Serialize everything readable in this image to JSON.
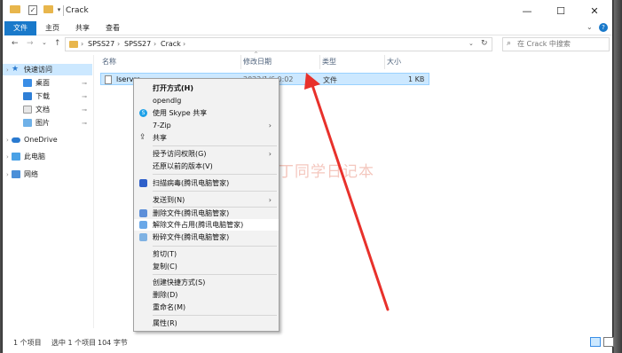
{
  "window": {
    "title": "Crack",
    "controls": {
      "minimize": "—",
      "maximize": "☐",
      "close": "✕"
    }
  },
  "ribbon": {
    "tabs": [
      "文件",
      "主页",
      "共享",
      "查看"
    ],
    "expand_glyph": "⌄",
    "help_glyph": "?"
  },
  "nav": {
    "back": "←",
    "forward": "→",
    "recent": "⌄",
    "up": "↑"
  },
  "address": {
    "crumbs": [
      "SPSS27",
      "SPSS27",
      "Crack"
    ],
    "separator": "›",
    "drop": "⌄",
    "refresh": "↻"
  },
  "search": {
    "placeholder": "在 Crack 中搜索",
    "icon": "⌕"
  },
  "sidebar": {
    "items": [
      {
        "label": "快速访问",
        "icon": "star-icon",
        "chev": "›",
        "selected": true
      },
      {
        "label": "桌面",
        "icon": "desktop-icon",
        "pinned": true
      },
      {
        "label": "下载",
        "icon": "download-icon",
        "pinned": true
      },
      {
        "label": "文档",
        "icon": "documents-icon",
        "pinned": true
      },
      {
        "label": "图片",
        "icon": "pictures-icon",
        "pinned": true
      },
      {
        "label": "OneDrive",
        "icon": "onedrive-icon",
        "chev": "›"
      },
      {
        "label": "此电脑",
        "icon": "pc-icon",
        "chev": "›"
      },
      {
        "label": "网络",
        "icon": "network-icon",
        "chev": "›"
      }
    ],
    "pin_glyph": "📌"
  },
  "columns": {
    "name": "名称",
    "date": "修改日期",
    "type": "类型",
    "size": "大小",
    "sort_glyph": "^"
  },
  "files": [
    {
      "name": "lservrc",
      "date": "2022/1/6 0:02",
      "type": "文件",
      "size": "1 KB"
    }
  ],
  "context_menu": {
    "items": [
      {
        "label": "打开方式(H)",
        "bold": true
      },
      {
        "label": "opendlg"
      },
      {
        "label": "使用 Skype 共享",
        "icon": "skype-icon",
        "icon_glyph": "S"
      },
      {
        "label": "7-Zip",
        "submenu": true
      },
      {
        "label": "共享",
        "icon": "share-icon",
        "icon_glyph": "⇪"
      },
      {
        "label": "授予访问权限(G)",
        "submenu": true
      },
      {
        "label": "还原以前的版本(V)"
      },
      {
        "label": "扫描病毒(腾讯电脑管家)",
        "icon": "shield-icon"
      },
      {
        "label": "发送到(N)",
        "submenu": true
      },
      {
        "label": "删除文件(腾讯电脑管家)",
        "icon": "delete-file-icon"
      },
      {
        "label": "解除文件占用(腾讯电脑管家)",
        "icon": "unlock-file-icon",
        "highlighted": true
      },
      {
        "label": "粉碎文件(腾讯电脑管家)",
        "icon": "shred-file-icon"
      },
      {
        "label": "剪切(T)"
      },
      {
        "label": "复制(C)"
      },
      {
        "label": "创建快捷方式(S)"
      },
      {
        "label": "删除(D)"
      },
      {
        "label": "重命名(M)"
      },
      {
        "label": "属性(R)"
      }
    ],
    "submenu_glyph": "›"
  },
  "watermark": {
    "text": "丁同学日记本"
  },
  "status": {
    "count": "1 个项目",
    "selected": "选中 1 个项目",
    "size": "104 字节"
  },
  "colors": {
    "accent": "#1979ca",
    "selection": "#cce8ff",
    "arrow": "#e8312b"
  }
}
